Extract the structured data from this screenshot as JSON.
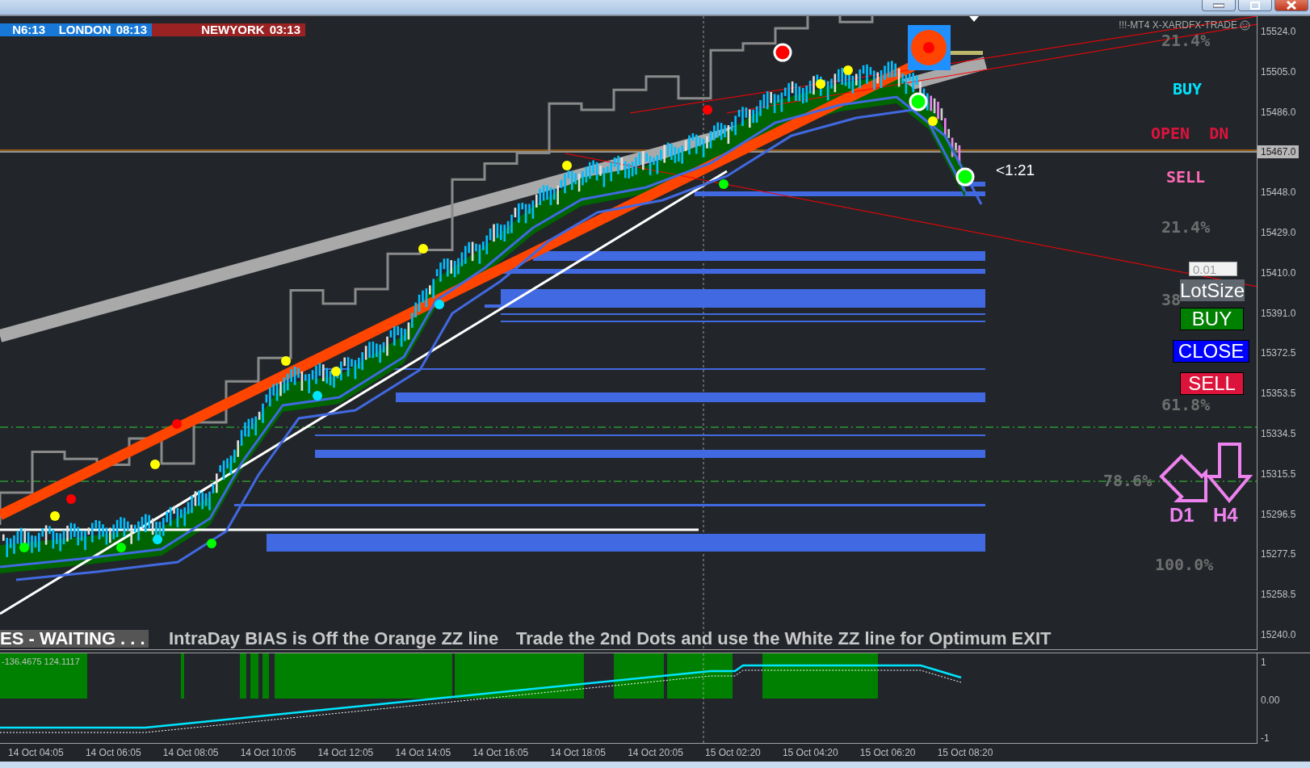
{
  "title": "!!!-MT4 X-XARDFX-TRADE",
  "sessions": [
    {
      "name": "N6:13",
      "color": "#1778d8"
    },
    {
      "name": "LONDON",
      "time": "08:13",
      "color": "#1778d8"
    },
    {
      "name": "NEWYORK",
      "time": "03:13",
      "color": "#9b2222"
    }
  ],
  "fib_levels": [
    "21.4%",
    "21.4%",
    "38",
    "61.8%",
    "78.6%",
    "100.0%"
  ],
  "signals": [
    {
      "text": "BUY",
      "color": "#00e5ff"
    },
    {
      "text": "OPEN  DN",
      "color": "#dc143c"
    },
    {
      "text": "SELL",
      "color": "#ff69b4"
    }
  ],
  "ratio_label": "<1:21",
  "trade_panel": {
    "lot_size": {
      "value": "0.01"
    },
    "lot_label": "LotSize",
    "buttons": [
      {
        "label": "BUY",
        "kind": "buy"
      },
      {
        "label": "CLOSE",
        "kind": "close"
      },
      {
        "label": "SELL",
        "kind": "sell"
      }
    ]
  },
  "timeframe_arrows": [
    {
      "label": "D1",
      "kind": "diagonal"
    },
    {
      "label": "H4",
      "kind": "down"
    }
  ],
  "messages": [
    {
      "text": "ES - WAITING . . .",
      "kind": "status"
    },
    {
      "text": "IntraDay BIAS is Off the Orange ZZ line",
      "kind": "hint"
    },
    {
      "text": "Trade the 2nd Dots and use the White ZZ line for Optimum EXIT",
      "kind": "hint"
    }
  ],
  "price_axis": [
    {
      "text": "15524.0",
      "current": false
    },
    {
      "text": "15505.0",
      "current": false
    },
    {
      "text": "15486.0",
      "current": false
    },
    {
      "text": "15467.0",
      "current": true
    },
    {
      "text": "15448.0",
      "current": false
    },
    {
      "text": "15429.0",
      "current": false
    },
    {
      "text": "15410.0",
      "current": false
    },
    {
      "text": "15391.0",
      "current": false
    },
    {
      "text": "15372.5",
      "current": false
    },
    {
      "text": "15353.5",
      "current": false
    },
    {
      "text": "15334.5",
      "current": false
    },
    {
      "text": "15315.5",
      "current": false
    },
    {
      "text": "15296.5",
      "current": false
    },
    {
      "text": "15277.5",
      "current": false
    },
    {
      "text": "15258.5",
      "current": false
    },
    {
      "text": "15240.0",
      "current": false
    }
  ],
  "indicator": {
    "values": "-136.4675 124.1117",
    "axis": [
      "1",
      "0.00",
      "-1"
    ]
  },
  "time_axis": [
    "14 Oct 04:05",
    "14 Oct 06:05",
    "14 Oct 08:05",
    "14 Oct 10:05",
    "14 Oct 12:05",
    "14 Oct 14:05",
    "14 Oct 16:05",
    "14 Oct 18:05",
    "14 Oct 20:05",
    "15 Oct 02:20",
    "15 Oct 04:20",
    "15 Oct 06:20",
    "15 Oct 08:20"
  ]
}
